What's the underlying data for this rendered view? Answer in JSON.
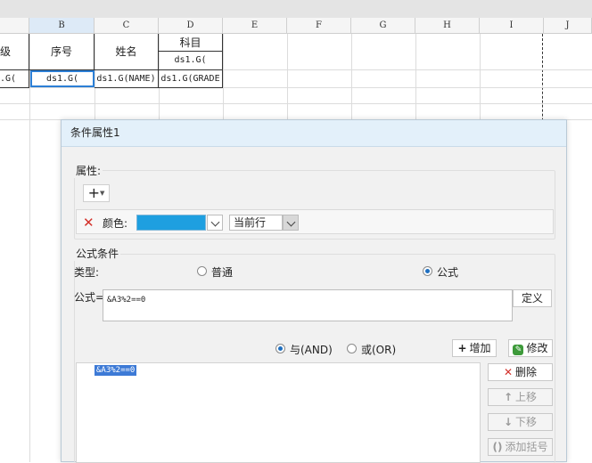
{
  "sheet": {
    "columns": [
      "B",
      "C",
      "D",
      "E",
      "F",
      "G",
      "H",
      "I",
      "J"
    ],
    "cells": {
      "a_header": "级",
      "b_header": "序号",
      "c_header": "姓名",
      "d_header": "科目",
      "d_sub": "ds1.G(",
      "a_data": ".G(",
      "b_data": "ds1.G(",
      "c_data": "ds1.G(NAME)",
      "d_data": "ds1.G(GRADE"
    }
  },
  "dialog": {
    "title": "条件属性1",
    "attributes_label": "属性:",
    "plus_label": "+",
    "color_label": "颜色:",
    "color_value": "#1e9fe0",
    "scope_value": "当前行",
    "formula_section_label": "公式条件",
    "type_label": "类型:",
    "type_options": [
      {
        "label": "普通",
        "selected": false
      },
      {
        "label": "公式",
        "selected": true
      }
    ],
    "formula_label": "公式=",
    "formula_value": "&A3%2==0",
    "define_button": "定义",
    "logic_options": [
      {
        "label": "与(AND)",
        "selected": true
      },
      {
        "label": "或(OR)",
        "selected": false
      }
    ],
    "add_button": "增加",
    "modify_button": "修改",
    "conditions": [
      "&A3%2==0"
    ],
    "delete_button": "删除",
    "move_up_button": "上移",
    "move_down_button": "下移",
    "add_bracket_button": "添加括号"
  }
}
